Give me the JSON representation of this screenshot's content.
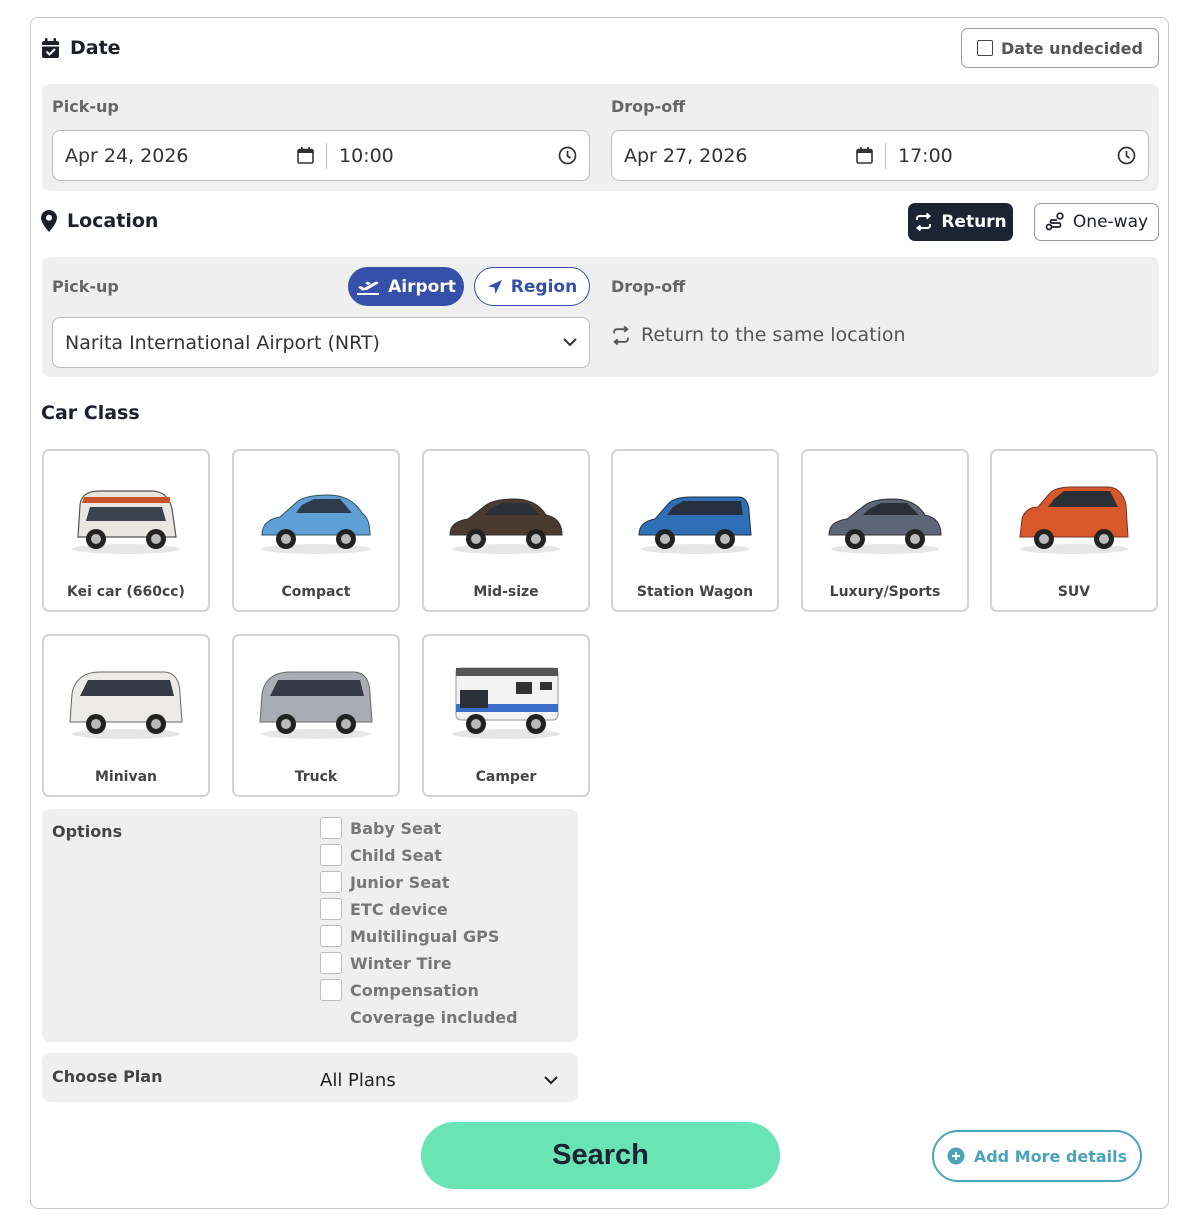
{
  "date": {
    "title": "Date",
    "undecided_label": "Date undecided",
    "pickup_label": "Pick-up",
    "dropoff_label": "Drop-off",
    "pickup_date": "Apr 24, 2026",
    "pickup_time": "10:00",
    "dropoff_date": "Apr 27, 2026",
    "dropoff_time": "17:00"
  },
  "location": {
    "title": "Location",
    "return_label": "Return",
    "oneway_label": "One-way",
    "pickup_label": "Pick-up",
    "dropoff_label": "Drop-off",
    "airport_label": "Airport",
    "region_label": "Region",
    "pickup_value": "Narita International Airport (NRT)",
    "dropoff_text": "Return to the same location"
  },
  "car_class": {
    "title": "Car Class",
    "cars": [
      {
        "label": "Kei car (660cc)",
        "color": "#e9e6e1"
      },
      {
        "label": "Compact",
        "color": "#5f9fd6"
      },
      {
        "label": "Mid-size",
        "color": "#4a3a30"
      },
      {
        "label": "Station Wagon",
        "color": "#2f6fb5"
      },
      {
        "label": "Luxury/Sports",
        "color": "#5c6676"
      },
      {
        "label": "SUV",
        "color": "#d9582a"
      },
      {
        "label": "Minivan",
        "color": "#ecebe8"
      },
      {
        "label": "Truck",
        "color": "#a9adb3"
      },
      {
        "label": "Camper",
        "color": "#f2f2f2"
      }
    ]
  },
  "options": {
    "title": "Options",
    "items": [
      "Baby Seat",
      "Child Seat",
      "Junior Seat",
      "ETC device",
      "Multilingual GPS",
      "Winter Tire",
      "Compensation Coverage included"
    ]
  },
  "plan": {
    "title": "Choose Plan",
    "value": "All Plans"
  },
  "actions": {
    "search_label": "Search",
    "more_label": "Add More details"
  },
  "colors": {
    "accent_blue": "#3550a8",
    "dark": "#1b2433",
    "search_green": "#69e4b4",
    "teal": "#4ba3b8"
  }
}
